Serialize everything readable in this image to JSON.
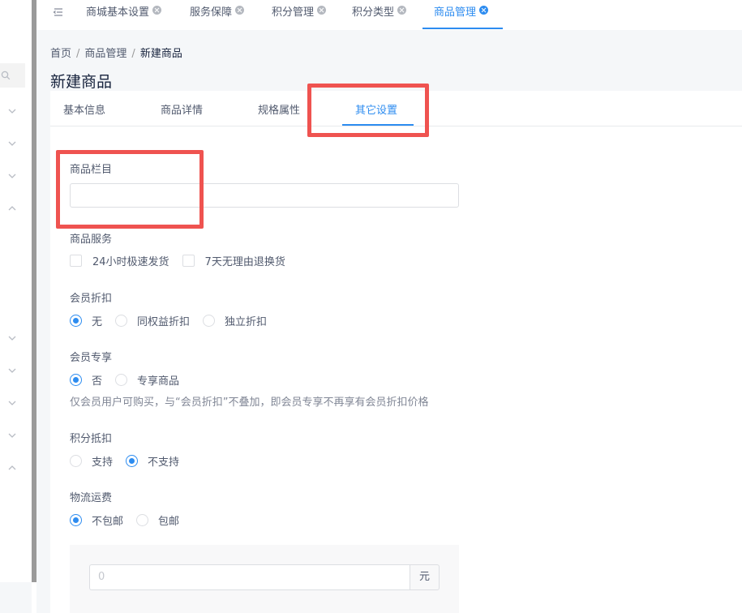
{
  "tabs": [
    {
      "label": "商城基本设置",
      "active": false
    },
    {
      "label": "服务保障",
      "active": false
    },
    {
      "label": "积分管理",
      "active": false
    },
    {
      "label": "积分类型",
      "active": false
    },
    {
      "label": "商品管理",
      "active": true
    }
  ],
  "breadcrumb": {
    "home": "首页",
    "section": "商品管理",
    "current": "新建商品",
    "separator": "/"
  },
  "page_title": "新建商品",
  "inner_tabs": [
    {
      "label": "基本信息",
      "active": false
    },
    {
      "label": "商品详情",
      "active": false
    },
    {
      "label": "规格属性",
      "active": false
    },
    {
      "label": "其它设置",
      "active": true
    }
  ],
  "form": {
    "category": {
      "label": "商品栏目",
      "value": ""
    },
    "services": {
      "label": "商品服务",
      "options": [
        "24小时极速发货",
        "7天无理由退换货"
      ]
    },
    "member_discount": {
      "label": "会员折扣",
      "options": [
        "无",
        "同权益折扣",
        "独立折扣"
      ],
      "selected": "无"
    },
    "member_exclusive": {
      "label": "会员专享",
      "options": [
        "否",
        "专享商品"
      ],
      "selected": "否",
      "hint": "仅会员用户可购买，与“会员折扣”不叠加，即会员专享不再享有会员折扣价格"
    },
    "points_deduction": {
      "label": "积分抵扣",
      "options": [
        "支持",
        "不支持"
      ],
      "selected": "不支持"
    },
    "shipping": {
      "label": "物流运费",
      "options": [
        "不包邮",
        "包邮"
      ],
      "selected": "不包邮",
      "fee_placeholder": "0",
      "fee_unit": "元"
    }
  },
  "colors": {
    "accent": "#2d8cf0",
    "highlight": "#ef5350",
    "text": "#515a6e"
  }
}
